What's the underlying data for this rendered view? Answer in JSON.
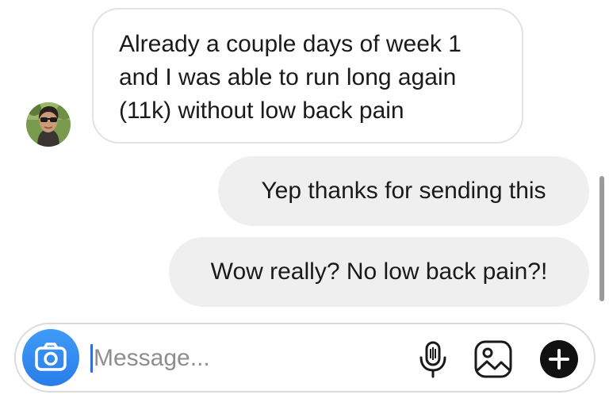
{
  "conversation": {
    "incoming": {
      "avatar": "contact-avatar",
      "text": "Already a couple days of week 1 and I was able to run long again (11k) without low back pain"
    },
    "outgoing": [
      {
        "text": "Yep thanks for sending this"
      },
      {
        "text": "Wow really? No low back pain?!"
      }
    ]
  },
  "composer": {
    "placeholder": "Message...",
    "value": "",
    "icons": {
      "camera": "camera-icon",
      "mic": "microphone-icon",
      "gallery": "gallery-icon",
      "plus": "plus-icon"
    }
  },
  "colors": {
    "camera_button": "#3897f0",
    "outgoing_bubble": "#efefef",
    "incoming_border": "#e2e2e2",
    "cursor": "#2f6de0"
  }
}
